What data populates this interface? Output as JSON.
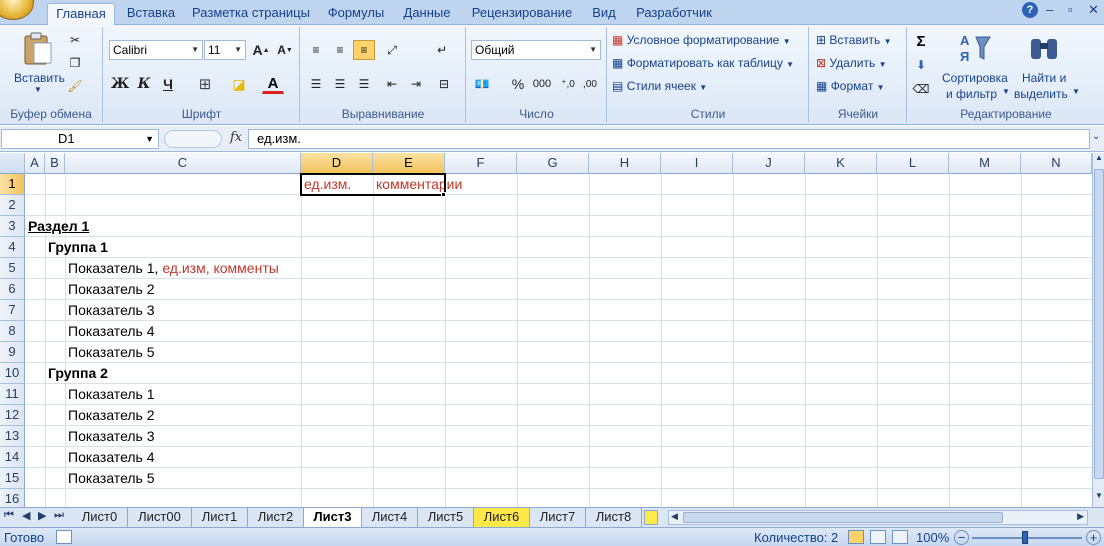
{
  "tabs": [
    "Главная",
    "Вставка",
    "Разметка страницы",
    "Формулы",
    "Данные",
    "Рецензирование",
    "Вид",
    "Разработчик"
  ],
  "clipboard": {
    "paste": "Вставить",
    "label": "Буфер обмена"
  },
  "font": {
    "name": "Calibri",
    "size": "11",
    "label": "Шрифт",
    "bold": "Ж",
    "italic": "К",
    "underline": "Ч"
  },
  "alignment": {
    "label": "Выравнивание"
  },
  "number": {
    "format": "Общий",
    "percent": "%",
    "thousands": "000",
    "label": "Число"
  },
  "styles": {
    "conditional": "Условное форматирование",
    "as_table": "Форматировать как таблицу",
    "cell_styles": "Стили ячеек",
    "label": "Стили"
  },
  "cells": {
    "insert": "Вставить",
    "delete": "Удалить",
    "format": "Формат",
    "label": "Ячейки"
  },
  "editing": {
    "sort_line1": "Сортировка",
    "sort_line2": "и фильтр",
    "find_line1": "Найти и",
    "find_line2": "выделить",
    "label": "Редактирование",
    "sigma": "Σ"
  },
  "formula_bar": {
    "name_box": "D1",
    "fx": "fx",
    "value": "ед.изм."
  },
  "columns": [
    "A",
    "B",
    "C",
    "D",
    "E",
    "F",
    "G",
    "H",
    "I",
    "J",
    "K",
    "L",
    "M",
    "N"
  ],
  "rows": [
    "1",
    "2",
    "3",
    "4",
    "5",
    "6",
    "7",
    "8",
    "9",
    "10",
    "11",
    "12",
    "13",
    "14",
    "15",
    "16"
  ],
  "cells_data": {
    "d1": "ед.изм.",
    "e1": "комментарии",
    "a3": "Раздел 1",
    "b4": "Группа 1",
    "c5_main": "Показатель 1",
    "c5_sep": ", ",
    "c5_red": "ед.изм, комменты",
    "c6": "Показатель 2",
    "c7": "Показатель 3",
    "c8": "Показатель 4",
    "c9": "Показатель 5",
    "b10": "Группа 2",
    "c11": "Показатель 1",
    "c12": "Показатель 2",
    "c13": "Показатель 3",
    "c14": "Показатель 4",
    "c15": "Показатель 5"
  },
  "sheets": [
    "Лист0",
    "Лист00",
    "Лист1",
    "Лист2",
    "Лист3",
    "Лист4",
    "Лист5",
    "Лист6",
    "Лист7",
    "Лист8"
  ],
  "active_sheet": "Лист3",
  "status": {
    "ready": "Готово",
    "count": "Количество: 2",
    "zoom": "100%"
  },
  "colors": {
    "ribbon": "#dbe7f6",
    "selected_header": "#f3c25b",
    "red_text": "#c0392b",
    "yellow_tab": "#ffe84a"
  }
}
